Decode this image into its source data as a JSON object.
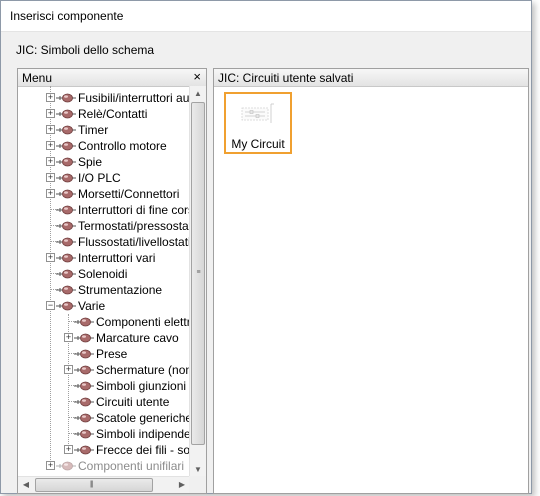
{
  "window": {
    "title": "Inserisci componente"
  },
  "subheading": "JIC: Simboli dello schema",
  "menu": {
    "header": "Menu",
    "close_glyph": "×",
    "items": [
      {
        "label": "Fusibili/interruttori autor",
        "expander": "+",
        "level": 0,
        "dim": false
      },
      {
        "label": "Relè/Contatti",
        "expander": "+",
        "level": 0,
        "dim": false
      },
      {
        "label": "Timer",
        "expander": "+",
        "level": 0,
        "dim": false
      },
      {
        "label": "Controllo motore",
        "expander": "+",
        "level": 0,
        "dim": false
      },
      {
        "label": "Spie",
        "expander": "+",
        "level": 0,
        "dim": false
      },
      {
        "label": "I/O PLC",
        "expander": "+",
        "level": 0,
        "dim": false
      },
      {
        "label": "Morsetti/Connettori",
        "expander": "+",
        "level": 0,
        "dim": false
      },
      {
        "label": "Interruttori di fine corsa",
        "expander": "",
        "level": 0,
        "dim": false
      },
      {
        "label": "Termostati/pressostati",
        "expander": "",
        "level": 0,
        "dim": false
      },
      {
        "label": "Flussostati/livellostati",
        "expander": "",
        "level": 0,
        "dim": false
      },
      {
        "label": "Interruttori vari",
        "expander": "+",
        "level": 0,
        "dim": false
      },
      {
        "label": "Solenoidi",
        "expander": "",
        "level": 0,
        "dim": false
      },
      {
        "label": "Strumentazione",
        "expander": "",
        "level": 0,
        "dim": false
      },
      {
        "label": "Varie",
        "expander": "−",
        "level": 0,
        "dim": false
      },
      {
        "label": "Componenti elettron",
        "expander": "",
        "level": 1,
        "dim": false
      },
      {
        "label": "Marcature cavo",
        "expander": "+",
        "level": 1,
        "dim": false
      },
      {
        "label": "Prese",
        "expander": "",
        "level": 1,
        "dim": false
      },
      {
        "label": "Schermature (non in",
        "expander": "+",
        "level": 1,
        "dim": false
      },
      {
        "label": "Simboli giunzioni",
        "expander": "",
        "level": 1,
        "dim": false
      },
      {
        "label": "Circuiti utente",
        "expander": "",
        "level": 1,
        "dim": false
      },
      {
        "label": "Scatole generiche",
        "expander": "",
        "level": 1,
        "dim": false
      },
      {
        "label": "Simboli indipendent",
        "expander": "",
        "level": 1,
        "dim": false
      },
      {
        "label": "Frecce dei fili - solo",
        "expander": "+",
        "level": 1,
        "dim": false
      },
      {
        "label": "Componenti unifilari",
        "expander": "+",
        "level": 0,
        "dim": true
      }
    ]
  },
  "content": {
    "header": "JIC: Circuiti utente salvati",
    "tiles": [
      {
        "label": "My Circuit"
      }
    ]
  },
  "colors": {
    "selection_border": "#f0a030",
    "tree_lines": "#a0a0a0"
  },
  "icons": {
    "tree_node": "component-symbol-icon",
    "scroll_up": "arrow-up-icon",
    "scroll_down": "arrow-down-icon",
    "scroll_left": "arrow-left-icon",
    "scroll_right": "arrow-right-icon"
  }
}
